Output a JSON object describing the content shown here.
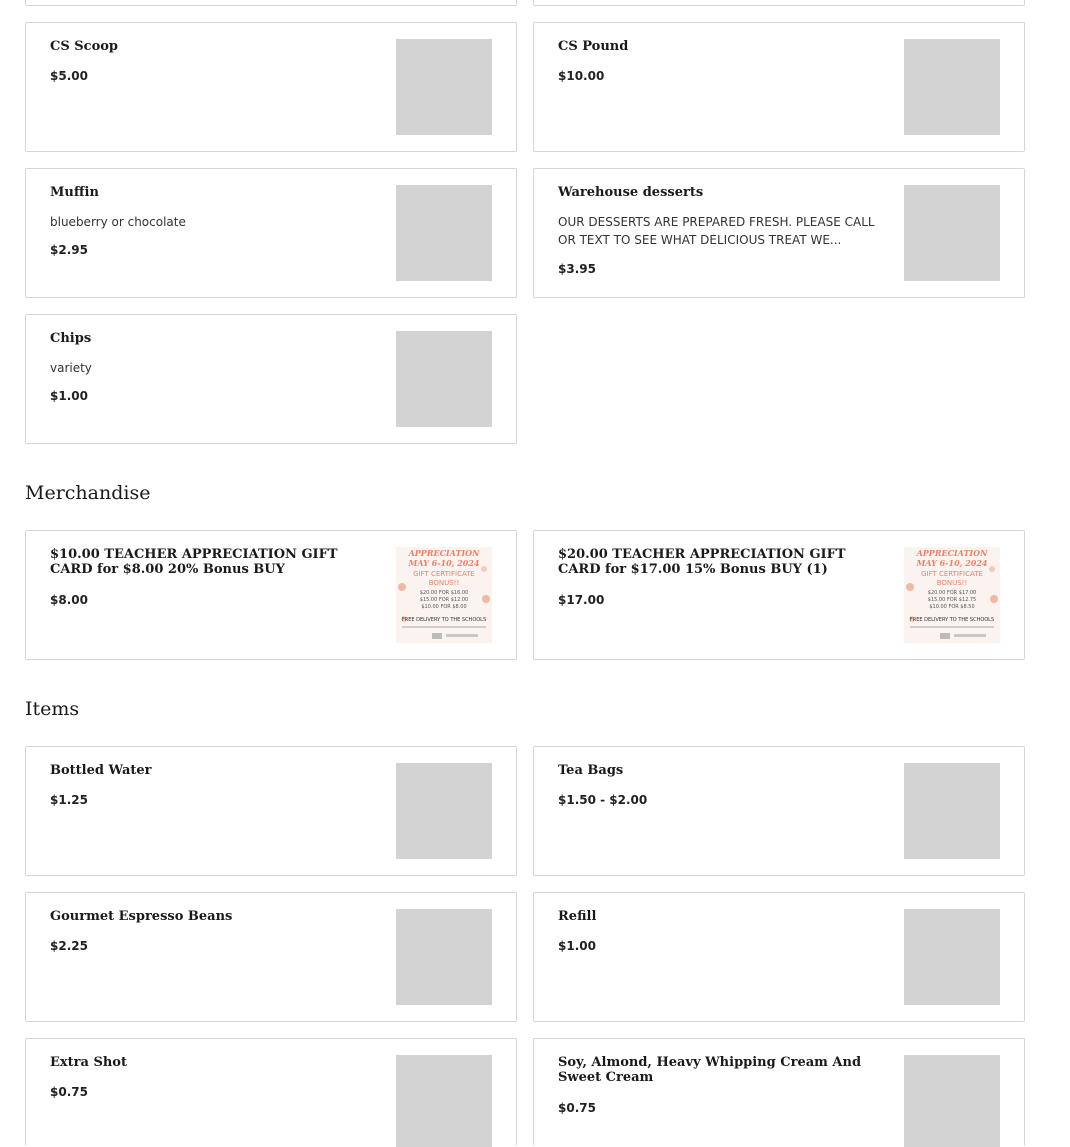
{
  "sections": [
    {
      "title": ""
    },
    {
      "title": "Merchandise"
    },
    {
      "title": "Items"
    }
  ],
  "desserts": [
    {
      "name": "CS Scoop",
      "description": "",
      "price": "$5.00"
    },
    {
      "name": "CS Pound",
      "description": "",
      "price": "$10.00"
    },
    {
      "name": "Muffin",
      "description": "blueberry or chocolate",
      "price": "$2.95"
    },
    {
      "name": "Warehouse desserts",
      "description": "OUR DESSERTS ARE PREPARED FRESH. PLEASE CALL OR TEXT TO SEE WHAT DELICIOUS TREAT WE...",
      "price": "$3.95"
    },
    {
      "name": "Chips",
      "description": "variety",
      "price": "$1.00"
    }
  ],
  "merchandise": [
    {
      "name": "$10.00 TEACHER APPRECIATION GIFT CARD for $8.00 20% Bonus BUY",
      "price": "$8.00",
      "flyer": {
        "l1": "APPRECIATION",
        "l2": "MAY 6-10, 2024",
        "l3": "GIFT CERTIFICATE",
        "l4": "BONUS!!",
        "l5": "$20.00 FOR $16.00",
        "l6": "$15.00 FOR $12.00",
        "l7": "$10.00 FOR $8.00",
        "l8": "FREE DELIVERY TO THE SCHOOLS"
      }
    },
    {
      "name": "$20.00 TEACHER APPRECIATION GIFT CARD for $17.00 15% Bonus BUY (1)",
      "price": "$17.00",
      "flyer": {
        "l1": "APPRECIATION",
        "l2": "MAY 6-10, 2024",
        "l3": "GIFT CERTIFICATE",
        "l4": "BONUS!!",
        "l5": "$20.00 FOR $17.00",
        "l6": "$15.00 FOR $12.75",
        "l7": "$10.00 FOR $8.50",
        "l8": "FREE DELIVERY TO THE SCHOOLS"
      }
    }
  ],
  "items": [
    {
      "name": "Bottled Water",
      "price": "$1.25"
    },
    {
      "name": "Tea Bags",
      "price": "$1.50 - $2.00"
    },
    {
      "name": "Gourmet Espresso Beans",
      "price": "$2.25"
    },
    {
      "name": "Refill",
      "price": "$1.00"
    },
    {
      "name": "Extra Shot",
      "price": "$0.75"
    },
    {
      "name": "Soy, Almond, Heavy Whipping Cream And Sweet Cream",
      "price": "$0.75"
    }
  ],
  "colors": {
    "placeholder": "#d3d3d3",
    "border": "#d6d6d6",
    "flyer_accent": "#e8826a"
  }
}
